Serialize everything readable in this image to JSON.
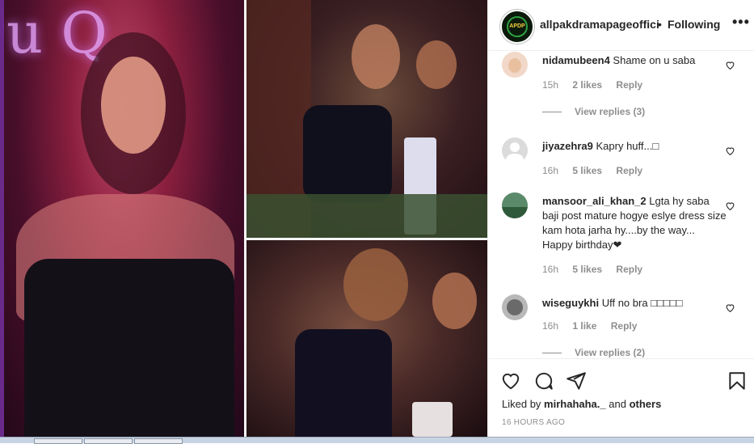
{
  "post": {
    "username": "allpakdramapageoffici",
    "separator": "•",
    "follow_status": "Following",
    "more_label": "•••",
    "avatar_text": "APDP"
  },
  "media": {
    "neon_text": "u Q"
  },
  "comments": [
    {
      "user": "nidamubeen4",
      "text": "Shame on u saba",
      "time": "15h",
      "likes": "2 likes",
      "reply": "Reply",
      "view_replies": "View replies (3)"
    },
    {
      "user": "jiyazehra9",
      "text": "Kapry huff...□",
      "time": "16h",
      "likes": "5 likes",
      "reply": "Reply"
    },
    {
      "user": "mansoor_ali_khan_2",
      "text": "Lgta hy saba baji post mature hogye eslye dress size kam hota jarha hy....by the way... Happy birthday❤",
      "time": "16h",
      "likes": "5 likes",
      "reply": "Reply"
    },
    {
      "user": "wiseguykhi",
      "text": "Uff no bra □□□□□",
      "time": "16h",
      "likes": "1 like",
      "reply": "Reply",
      "view_replies": "View replies (2)"
    }
  ],
  "footer": {
    "liked_prefix": "Liked by ",
    "liked_user": "mirhahaha._",
    "liked_and": " and ",
    "liked_others": "others",
    "timestamp": "16 HOURS AGO"
  },
  "icons": [
    "heart-icon",
    "comment-icon",
    "share-icon",
    "bookmark-icon",
    "more-icon"
  ],
  "colors": {
    "text": "#262626",
    "muted": "#8e8e8e",
    "border": "#efefef"
  }
}
